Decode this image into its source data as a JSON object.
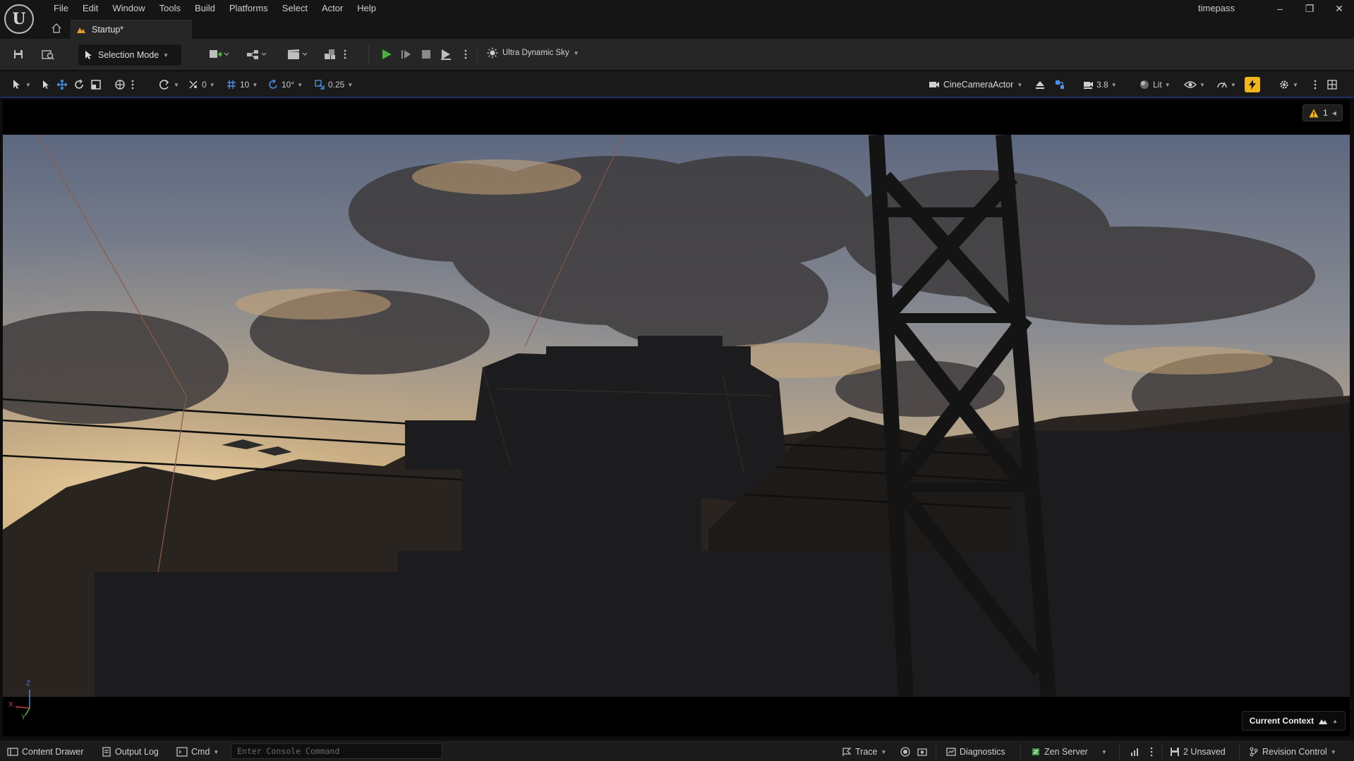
{
  "app": {
    "logo_text": "U",
    "project_name": "timepass",
    "menu": [
      "File",
      "Edit",
      "Window",
      "Tools",
      "Build",
      "Platforms",
      "Select",
      "Actor",
      "Help"
    ],
    "tab_label": "Startup*",
    "window_buttons": [
      "minimize",
      "restore",
      "close"
    ]
  },
  "toolbar": {
    "selection_mode_label": "Selection Mode",
    "sky_label": "Ultra Dynamic Sky",
    "icons": [
      "save-icon",
      "content-browser-icon",
      "add-actor-icon",
      "blueprint-icon",
      "cinematics-icon",
      "build-icon",
      "play-icon",
      "advance-frame-icon",
      "stop-icon",
      "launch-icon"
    ]
  },
  "viewport_toolbar": {
    "rotation_snap_value": "0",
    "grid_snap_value": "10",
    "angle_snap_value": "10°",
    "scale_snap_value": "0.25",
    "camera_actor": "CineCameraActor",
    "camera_speed": "3.8",
    "view_mode": "Lit"
  },
  "viewport": {
    "warning_count": "1",
    "axis_labels": {
      "x": "X",
      "y": "Y",
      "z": "Z"
    },
    "current_context_label": "Current Context"
  },
  "statusbar": {
    "content_drawer": "Content Drawer",
    "output_log": "Output Log",
    "cmd": "Cmd",
    "console_placeholder": "Enter Console Command",
    "trace": "Trace",
    "diagnostics": "Diagnostics",
    "zen_server": "Zen Server",
    "unsaved": "2 Unsaved",
    "revision_control": "Revision Control"
  },
  "colors": {
    "play_green": "#4caf3f",
    "warning_yellow": "#f2b51e",
    "accent_blue": "#1d2d66"
  }
}
